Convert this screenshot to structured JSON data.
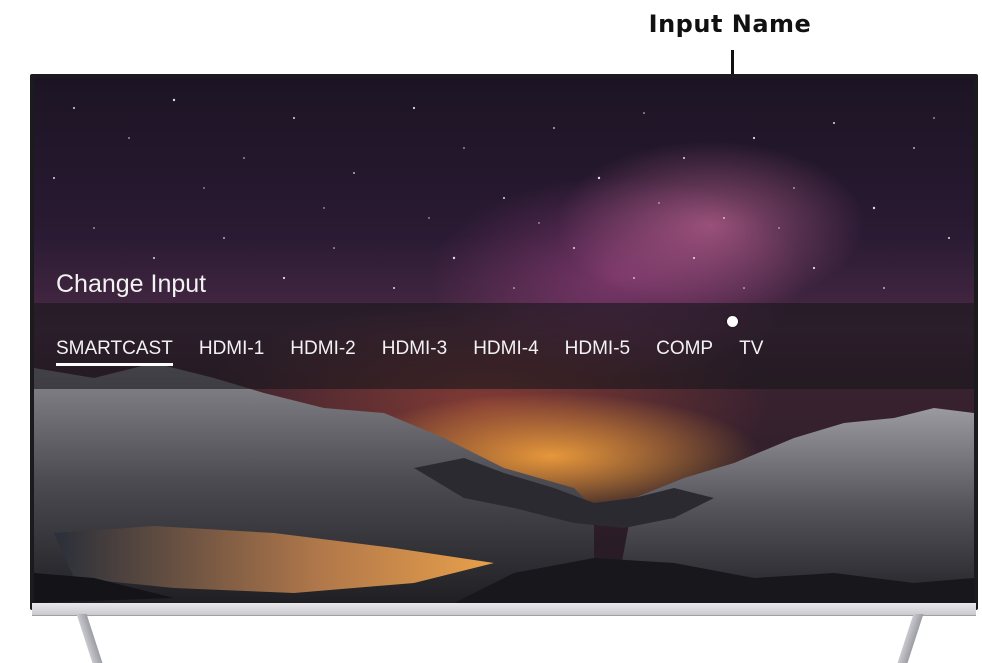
{
  "callout": {
    "label": "Input Name"
  },
  "menu": {
    "title": "Change Input",
    "inputs": [
      "SMARTCAST",
      "HDMI-1",
      "HDMI-2",
      "HDMI-3",
      "HDMI-4",
      "HDMI-5",
      "COMP",
      "TV"
    ],
    "selected": "SMARTCAST"
  },
  "colors": {
    "callout_text": "#111111",
    "menu_text": "#f2f2f2",
    "selection_underline": "#ffffff"
  }
}
